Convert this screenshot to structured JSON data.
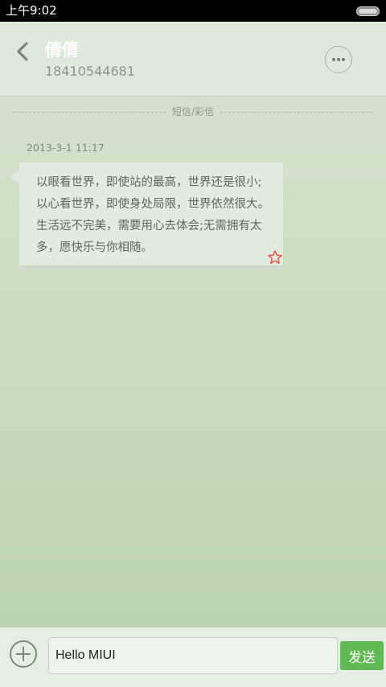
{
  "status": {
    "time": "上午9:02"
  },
  "header": {
    "contact_name": "倩倩",
    "contact_number": "18410544681"
  },
  "conversation": {
    "divider_label": "短信/彩信",
    "messages": [
      {
        "timestamp": "2013-3-1 11:17",
        "text": "以眼看世界，即使站的最高，世界还是很小;以心看世界，即使身处局限，世界依然很大。生活远不完美，需要用心去体会;无需拥有太多，愿快乐与你相随。"
      }
    ]
  },
  "composer": {
    "input_value": "Hello MIUI",
    "send_label": "发送"
  },
  "colors": {
    "send_button": "#5dbb51",
    "star": "#e2534a"
  }
}
